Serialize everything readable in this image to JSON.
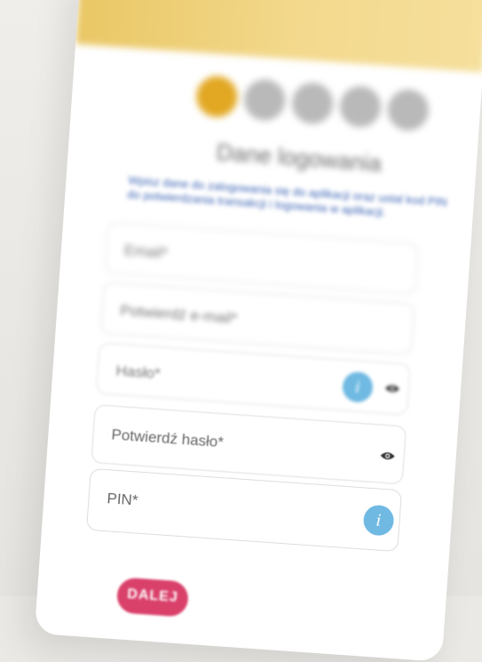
{
  "header": {
    "title": "Dane logowania",
    "description": "Wpisz dane do zalogowania się do aplikacji oraz ustal kod PIN do potwierdzania transakcji i logowania w aplikacji."
  },
  "steps": {
    "total": 5,
    "current": 1
  },
  "form": {
    "email": {
      "placeholder": "Email*"
    },
    "confirm_email": {
      "placeholder": "Potwierdź e-mail*"
    },
    "password": {
      "placeholder": "Hasło*",
      "info": "i"
    },
    "confirm_password": {
      "placeholder": "Potwierdź hasło*"
    },
    "pin": {
      "placeholder": "PIN*",
      "info": "i"
    }
  },
  "actions": {
    "next_label": "DALEJ"
  },
  "colors": {
    "banner": "#e9c765",
    "step_active": "#e2a823",
    "step_inactive": "#b9b9b9",
    "info": "#6fb9e2",
    "primary_button": "#d9406a"
  },
  "icons": {
    "info": "info-icon",
    "eye": "eye-icon"
  }
}
